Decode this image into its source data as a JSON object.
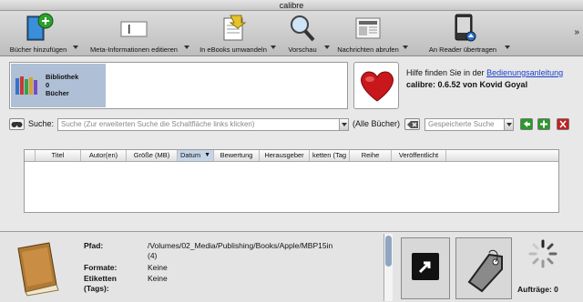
{
  "window": {
    "title": "calibre"
  },
  "toolbar": {
    "add_books": "Bücher hinzufügen",
    "edit_meta": "Meta-Informationen editieren",
    "convert": "In eBooks umwandeln",
    "preview": "Vorschau",
    "news": "Nachrichten abrufen",
    "send": "An Reader übertragen",
    "overflow": "»"
  },
  "library": {
    "line1": "Bibliothek",
    "line2": "0",
    "line3": "Bücher"
  },
  "help": {
    "prefix": "Hilfe finden Sie in der ",
    "link": "Bedienungsanleitung",
    "version_prefix": "calibre",
    "version_suffix": ": 0.6.52 von Kovid Goyal"
  },
  "search": {
    "label": "Suche:",
    "placeholder": "Suche (Zur erweiterten Suche die Schaltfläche links klicken)",
    "all_books": "(Alle Bücher)",
    "saved_placeholder": "Gespeicherte Suche"
  },
  "table": {
    "columns": [
      "Titel",
      "Autor(en)",
      "Größe (MB)",
      "Datum",
      "Bewertung",
      "Herausgeber",
      "ketten (Tag",
      "Reihe",
      "Veröffentlicht"
    ]
  },
  "details": {
    "path_label": "Pfad:",
    "path_value": "/Volumes/02_Media/Publishing/Books/Apple/MBP15in",
    "path_count": "(4)",
    "formats_label": "Formate:",
    "formats_value": "Keine",
    "tags_label": "Etiketten",
    "tags_label2": "(Tags):",
    "tags_value": "Keine"
  },
  "jobs": {
    "label": "Aufträge: 0"
  }
}
